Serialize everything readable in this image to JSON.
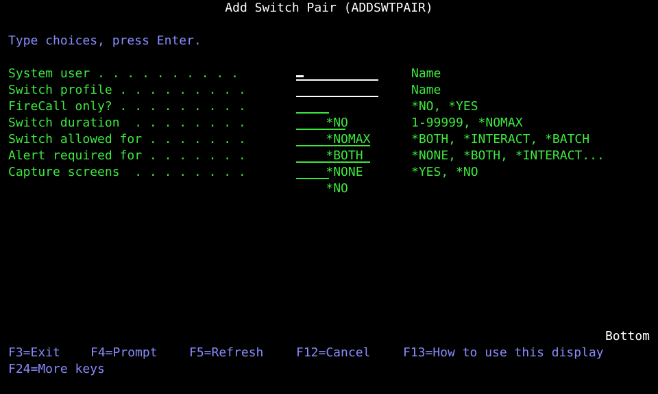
{
  "title": "Add Switch Pair (ADDSWTPAIR)",
  "instruction": "Type choices, press Enter.",
  "fields": [
    {
      "label": "System user . . . . . . . . . . ",
      "value": "",
      "hint": "Name"
    },
    {
      "label": "Switch profile . . . . . . . . .",
      "value": "",
      "hint": "Name"
    },
    {
      "label": "FireCall only? . . . . . . . . .",
      "value": "*NO",
      "hint": "*NO, *YES"
    },
    {
      "label": "Switch duration  . . . . . . . .",
      "value": "*NOMAX",
      "hint": "1-99999, *NOMAX"
    },
    {
      "label": "Switch allowed for . . . . . . .",
      "value": "*BOTH",
      "hint": "*BOTH, *INTERACT, *BATCH"
    },
    {
      "label": "Alert required for . . . . . . .",
      "value": "*NONE",
      "hint": "*NONE, *BOTH, *INTERACT..."
    },
    {
      "label": "Capture screens  . . . . . . . .",
      "value": "*NO",
      "hint": "*YES, *NO"
    }
  ],
  "more_indicator": "Bottom",
  "function_keys": {
    "f3": "F3=Exit",
    "f4": "F4=Prompt",
    "f5": "F5=Refresh",
    "f12": "F12=Cancel",
    "f13": "F13=How to use this display",
    "f24": "F24=More keys"
  },
  "colors": {
    "background": "#000000",
    "text_white": "#ffffff",
    "text_blue": "#8a8cff",
    "text_green": "#3ee83e"
  }
}
